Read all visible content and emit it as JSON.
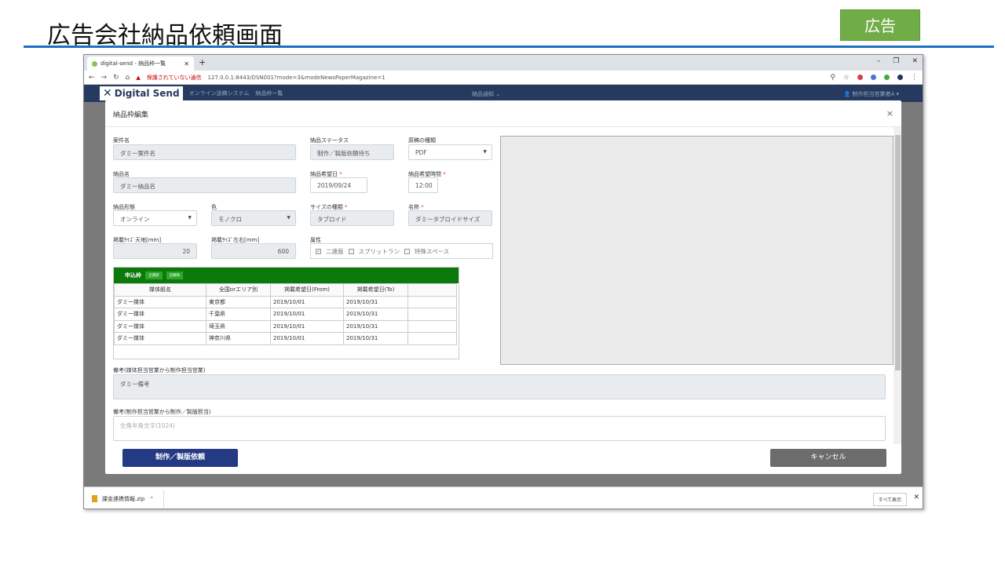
{
  "slide": {
    "title": "広告会社納品依頼画面",
    "badge": "広告"
  },
  "browser": {
    "tab_title": "digital-send - 納品枠一覧",
    "new_tab": "+",
    "security_warning": "保護されていない通信",
    "url": "127.0.0.1:8443/DSN001?mode=3&modeNewsPaperMagazine=1"
  },
  "app": {
    "logo": "Digital Send",
    "system_name": "オンライン送稿システム",
    "breadcrumb": "納品枠一覧",
    "notice": "納品通知",
    "user": "制作担当営業者A"
  },
  "modal": {
    "title": "納品枠編集",
    "close": "×",
    "case_name": {
      "label": "案件名",
      "value": "ダミー案件名"
    },
    "status": {
      "label": "納品ステータス",
      "value": "制作／製版依頼待ち"
    },
    "material_type": {
      "label": "原稿の種類",
      "value": "PDF"
    },
    "delivery_name": {
      "label": "納品名",
      "value": "ダミー納品名"
    },
    "desired_date": {
      "label": "納品希望日",
      "value": "2019/09/24"
    },
    "desired_time": {
      "label": "納品希望時間",
      "value": "12:00"
    },
    "delivery_form": {
      "label": "納品形態",
      "value": "オンライン"
    },
    "color": {
      "label": "色",
      "value": "モノクロ"
    },
    "size_type": {
      "label": "サイズの種類",
      "value": "タブロイド"
    },
    "size_name": {
      "label": "名称",
      "value": "ダミータブロイドサイズ"
    },
    "height": {
      "label": "掲載ｻｲｽﾞ天地[mm]",
      "value": "20"
    },
    "width": {
      "label": "掲載ｻｲｽﾞ左右[mm]",
      "value": "600"
    },
    "attributes": {
      "label": "属性",
      "items": [
        "二連版",
        "スプリットラン",
        "特殊スペース"
      ],
      "checked": [
        true,
        false,
        false
      ]
    },
    "required_mark": "*",
    "grid": {
      "title": "申込枠",
      "select_all": "全選択",
      "clear_all": "全解除",
      "columns": [
        "媒体紙名",
        "全国orエリア別",
        "掲載希望日(From)",
        "掲載希望日(To)",
        ""
      ],
      "rows": [
        [
          "ダミー媒体",
          "東京都",
          "2019/10/01",
          "2019/10/31",
          ""
        ],
        [
          "ダミー媒体",
          "千葉県",
          "2019/10/01",
          "2019/10/31",
          ""
        ],
        [
          "ダミー媒体",
          "埼玉県",
          "2019/10/01",
          "2019/10/31",
          ""
        ],
        [
          "ダミー媒体",
          "神奈川県",
          "2019/10/01",
          "2019/10/31",
          ""
        ]
      ]
    },
    "remarks1": {
      "label": "備考(媒体担当営業から制作担当営業)",
      "value": "ダミー備考"
    },
    "remarks2": {
      "label": "備考(制作担当営業から制作／製版担当)",
      "placeholder": "全角半角文字(1024)"
    },
    "submit": "制作／製版依頼",
    "cancel": "キャンセル"
  },
  "download": {
    "file": "課金連携情報.zip",
    "show_all": "すべて表示"
  }
}
